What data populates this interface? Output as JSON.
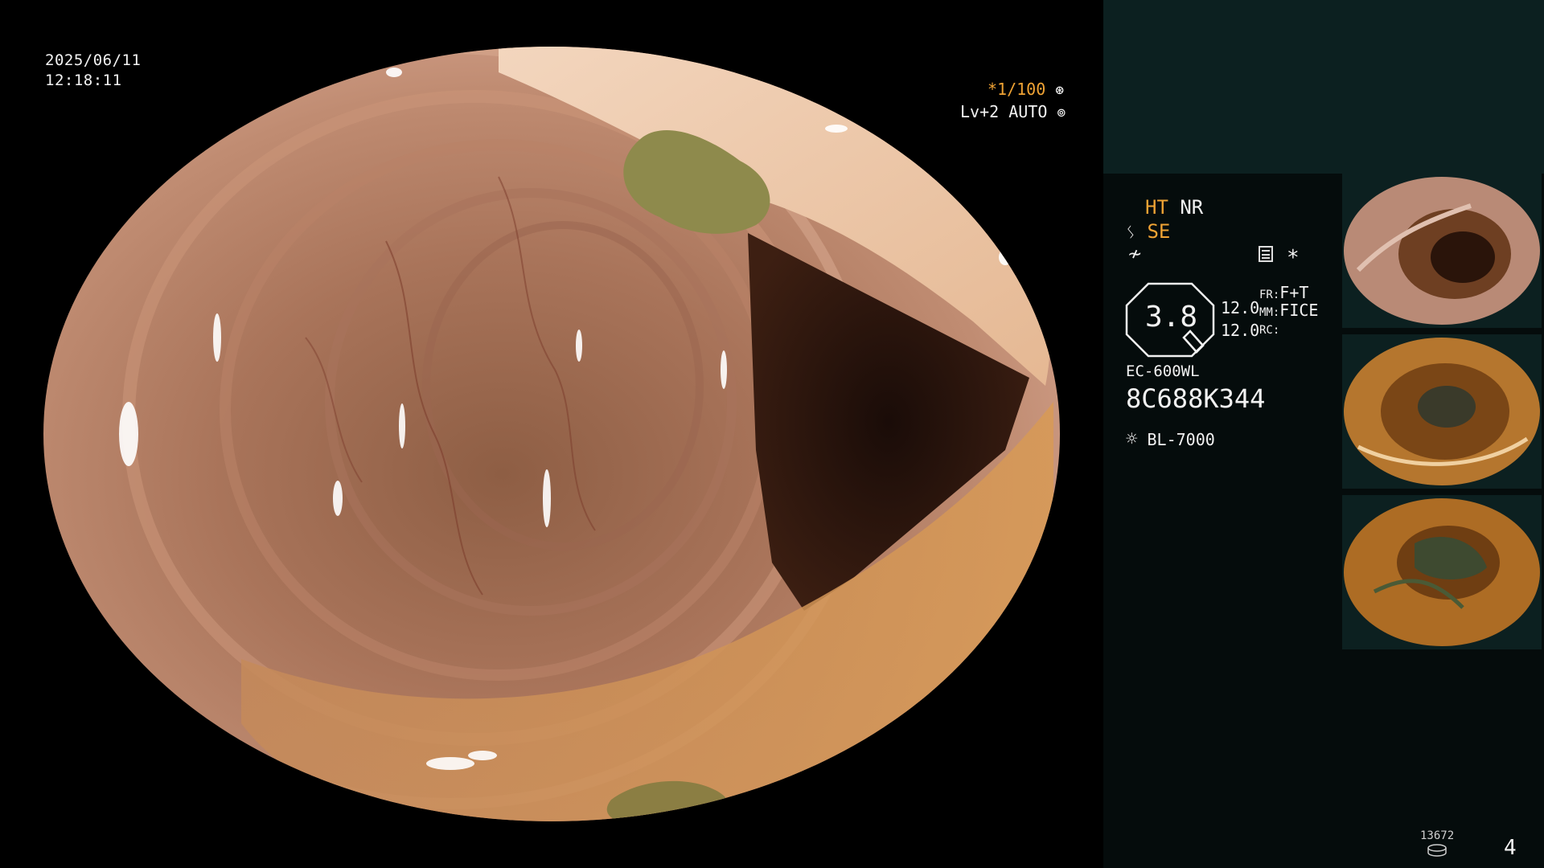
{
  "overlay": {
    "date": "2025/06/11",
    "time": "12:18:11",
    "shutter": "*1/100",
    "level": "Lv+2 AUTO"
  },
  "panel": {
    "ht": "HT",
    "nr": "NR",
    "se": "SE",
    "asterisk": "*",
    "magnification": "3.8",
    "val_a": "12.0",
    "val_b": "12.0",
    "fr_label": "FR:",
    "fr_value": "F+T",
    "mm_label": "MM:",
    "mm_value": "FICE",
    "rc_label": "RC:",
    "scope_model": "EC-600WL",
    "serial": "8C688K344",
    "light_source": "BL-7000",
    "counter": "13672",
    "image_count": "4"
  },
  "colors": {
    "accent_orange": "#f0a334",
    "panel_bg": "#050c0c",
    "panel_top_bg": "#0c2020"
  },
  "icons": [
    "freeze-icon",
    "shutter-icon",
    "auto-icon",
    "structure-enhancement-icon",
    "se-icon",
    "color-icon",
    "settings-icon",
    "light-source-icon",
    "disk-icon"
  ]
}
